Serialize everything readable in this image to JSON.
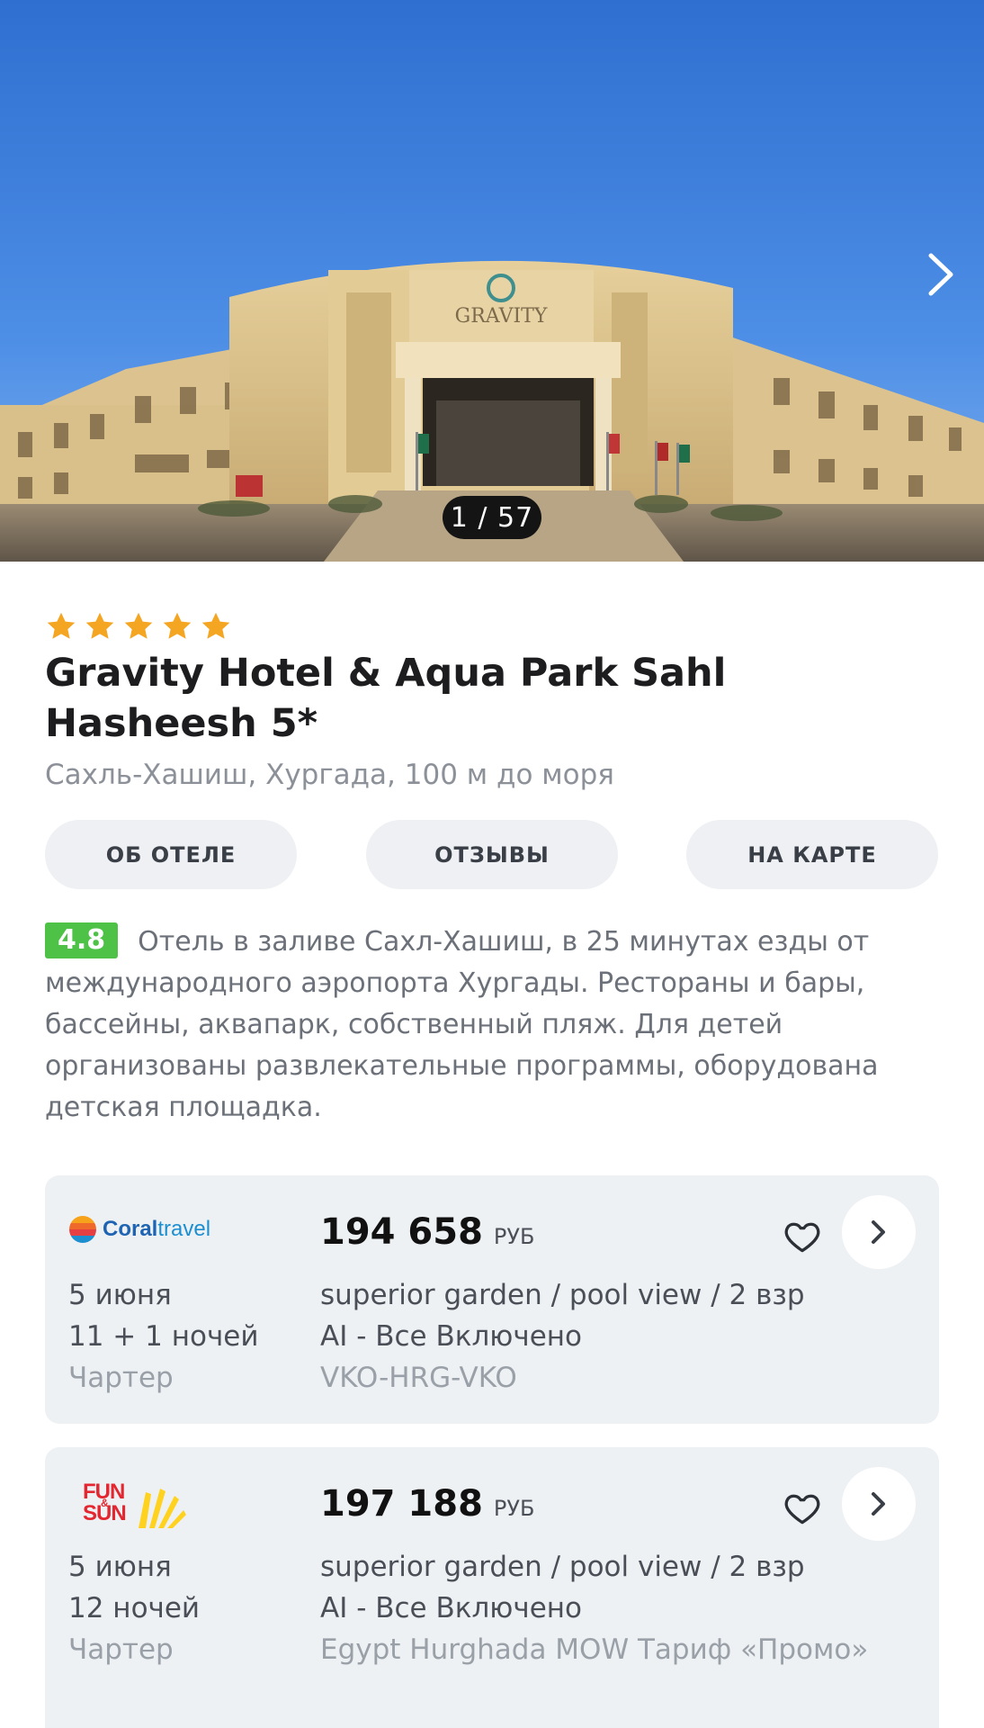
{
  "gallery": {
    "counter": "1 / 57",
    "sign_text": "GRAVITY"
  },
  "hotel": {
    "stars": 5,
    "name": "Gravity Hotel & Aqua Park Sahl Hasheesh 5*",
    "location": "Сахль-Хашиш, Хургада, 100 м до моря"
  },
  "tabs": [
    {
      "label": "ОБ ОТЕЛЕ"
    },
    {
      "label": "ОТЗЫВЫ"
    },
    {
      "label": "НА КАРТЕ"
    }
  ],
  "description": {
    "rating": "4.8",
    "text": "Отель в заливе Сахл-Хашиш, в 25 минутах езды от международного аэропорта Хургады. Рестораны и бары, бассейны, аквапарк, собственный пляж. Для детей организованы развлекательные программы, оборудована детская площадка."
  },
  "offers": [
    {
      "operator": "Coral travel",
      "logo_brand": "Coral",
      "logo_suffix": "travel",
      "price": "194 658",
      "currency": "РУБ",
      "date": "5 июня",
      "nights": "11 + 1 ночей",
      "flight_type": "Чартер",
      "room": "superior garden / pool view / 2 взр",
      "meal": "AI - Все Включено",
      "tariff": "VKO-HRG-VKO"
    },
    {
      "operator": "FUN & SUN",
      "logo_line1": "FUN",
      "logo_amp": "&",
      "logo_line2": "SUN",
      "price": "197 188",
      "currency": "РУБ",
      "date": "5 июня",
      "nights": "12 ночей",
      "flight_type": "Чартер",
      "room": "superior garden / pool view / 2 взр",
      "meal": "AI - Все Включено",
      "tariff": "Egypt Hurghada MOW Тариф «Промо»"
    }
  ],
  "colors": {
    "star": "#f4a623",
    "rating_badge": "#4dc247",
    "card_bg": "#eef1f4",
    "tab_bg": "#eef0f3"
  },
  "icons": [
    "chevron-right-icon",
    "star-icon",
    "heart-icon"
  ]
}
